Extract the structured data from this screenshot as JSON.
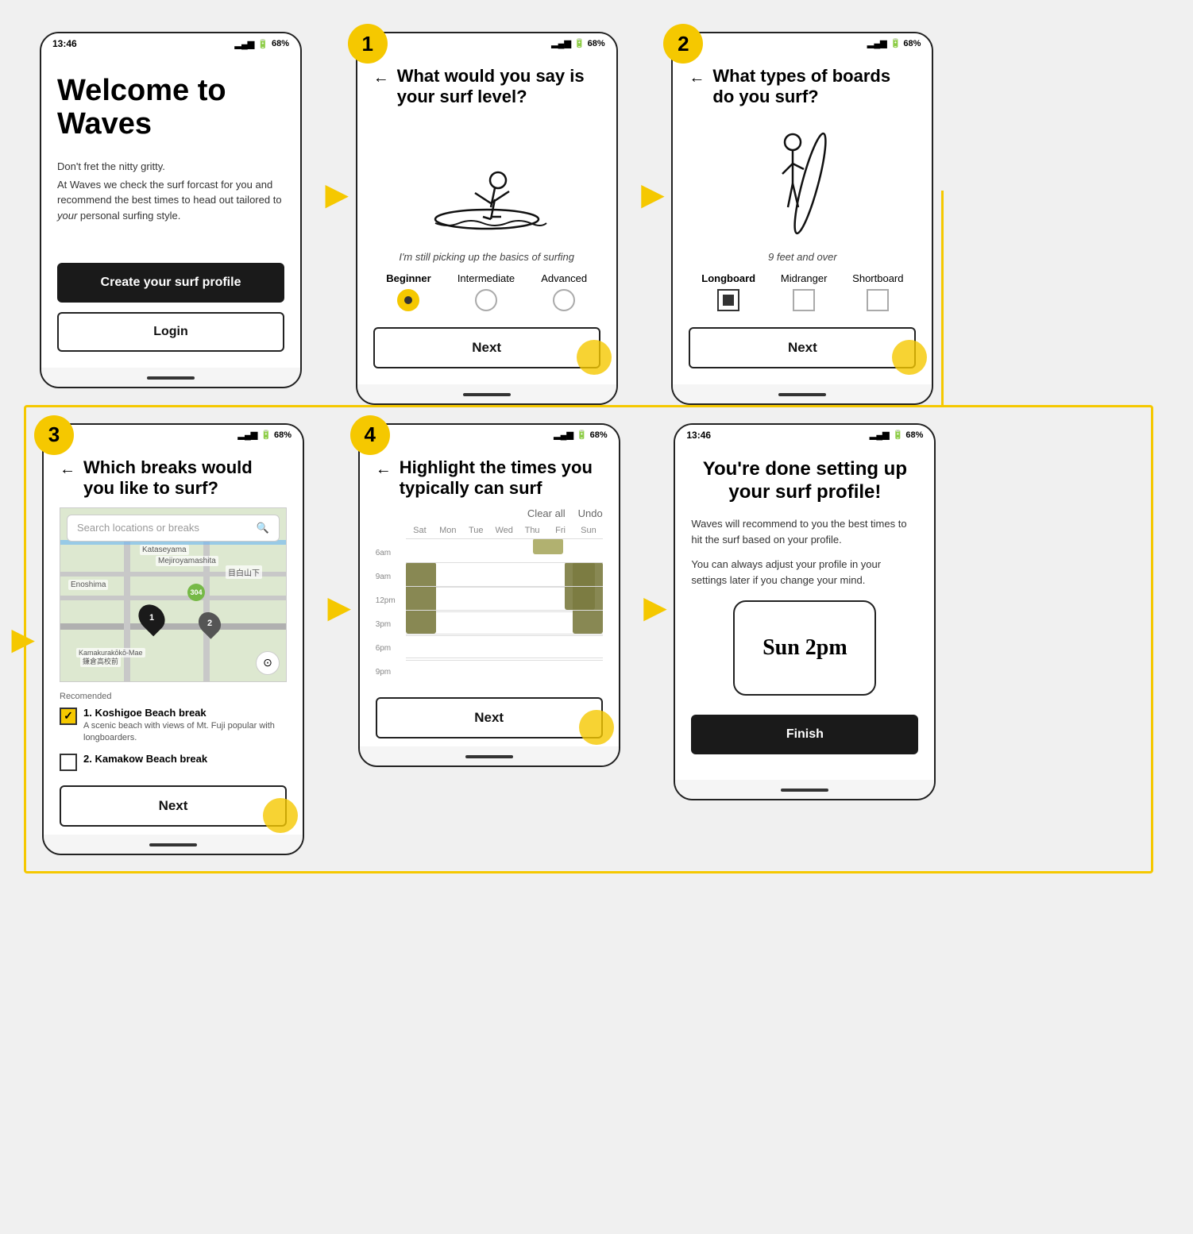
{
  "app": {
    "name": "Waves"
  },
  "statusBar": {
    "time": "13:46",
    "signal": "▂▄▆",
    "battery": "68%"
  },
  "screens": {
    "welcome": {
      "title": "Welcome to Waves",
      "subtitle": "Don't fret the nitty gritty.",
      "description": "At Waves we check the surf forcast for you and recommend the best times to head out tailored to your personal surfing style.",
      "cta_button": "Create your surf profile",
      "login_button": "Login"
    },
    "screen1": {
      "step": "1",
      "question": "What would you say is your surf level?",
      "back": "←",
      "caption": "I'm still picking up the basics of surfing",
      "options": [
        {
          "label": "Beginner",
          "active": true
        },
        {
          "label": "Intermediate",
          "active": false
        },
        {
          "label": "Advanced",
          "active": false
        }
      ],
      "next_button": "Next"
    },
    "screen2": {
      "step": "2",
      "question": "What types of boards do you surf?",
      "back": "←",
      "caption": "9 feet and over",
      "options": [
        {
          "label": "Longboard",
          "active": true
        },
        {
          "label": "Midranger",
          "active": false
        },
        {
          "label": "Shortboard",
          "active": false
        }
      ],
      "next_button": "Next"
    },
    "screen3": {
      "step": "3",
      "question": "Which breaks would you like to surf?",
      "back": "←",
      "search_placeholder": "Search locations or breaks",
      "map_labels": [
        "Kataseyama",
        "Mejiroyamashita",
        "目白山下",
        "Enoshima",
        "Kamakurakōkō-Mae",
        "鎌倉高校前"
      ],
      "recommended_label": "Recomended",
      "beaches": [
        {
          "name": "Koshigoe",
          "type": "Beach break",
          "desc": "A scenic beach with views of Mt. Fuji popular with longboarders.",
          "active": true
        },
        {
          "name": "Kamakow",
          "type": "Beach break",
          "desc": "",
          "active": false
        }
      ],
      "next_button": "Next"
    },
    "screen4": {
      "step": "4",
      "question": "Highlight the times you typically can surf",
      "back": "←",
      "clear_all": "Clear all",
      "undo": "Undo",
      "days": [
        "Sat",
        "Mon",
        "Tue",
        "Wed",
        "Thu",
        "Fri",
        "Sun"
      ],
      "times": [
        "6am",
        "9am",
        "12pm",
        "3pm",
        "6pm",
        "9pm"
      ],
      "next_button": "Next"
    },
    "screen5": {
      "title": "You're done setting up your surf profile!",
      "description1": "Waves will recommend to you the best times to hit the surf based on your profile.",
      "description2": "You can always adjust your profile in your settings later if you change your mind.",
      "image_text": "Sun 2pm",
      "finish_button": "Finish"
    }
  }
}
